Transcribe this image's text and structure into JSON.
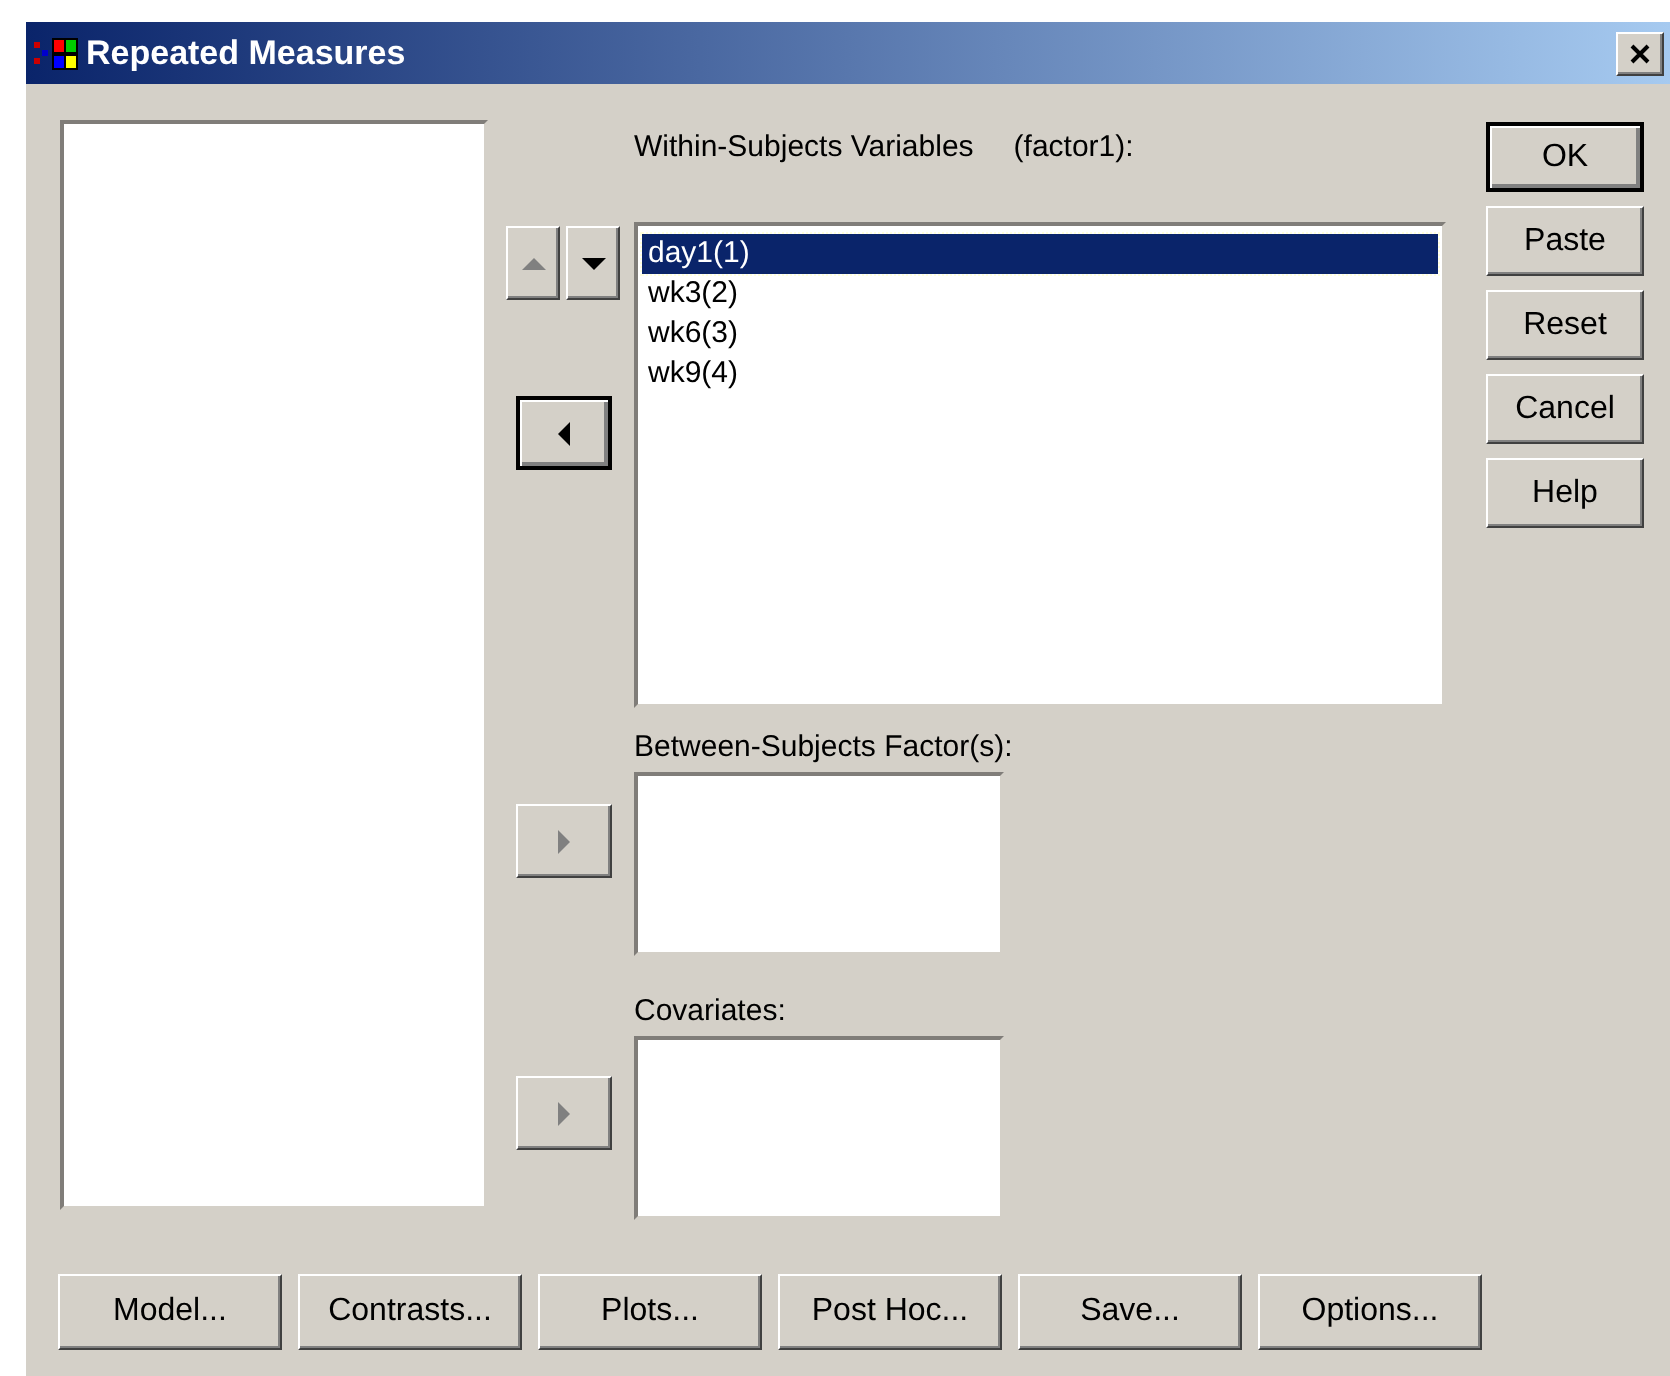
{
  "window": {
    "title": "Repeated Measures"
  },
  "within": {
    "label": "Within-Subjects Variables",
    "factor": "(factor1):",
    "items": [
      {
        "text": "day1(1)",
        "selected": true
      },
      {
        "text": "wk3(2)",
        "selected": false
      },
      {
        "text": "wk6(3)",
        "selected": false
      },
      {
        "text": "wk9(4)",
        "selected": false
      }
    ],
    "up_disabled": true,
    "down_disabled": false,
    "move_disabled": false,
    "move_default": true
  },
  "between": {
    "label": "Between-Subjects Factor(s):",
    "move_disabled": true
  },
  "covariates": {
    "label": "Covariates:",
    "move_disabled": true
  },
  "side_buttons": [
    {
      "label": "OK",
      "default": true
    },
    {
      "label": "Paste",
      "default": false
    },
    {
      "label": "Reset",
      "default": false
    },
    {
      "label": "Cancel",
      "default": false
    },
    {
      "label": "Help",
      "default": false
    }
  ],
  "bottom_buttons": [
    "Model...",
    "Contrasts...",
    "Plots...",
    "Post Hoc...",
    "Save...",
    "Options..."
  ]
}
